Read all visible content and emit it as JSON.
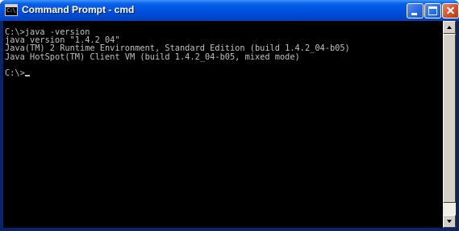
{
  "window": {
    "title": "Command Prompt - cmd",
    "icon": "cmd-icon",
    "icon_text": "C:\\",
    "buttons": {
      "minimize_icon": "minimize-icon",
      "maximize_icon": "maximize-icon",
      "close_icon": "close-icon"
    }
  },
  "console": {
    "lines": [
      "C:\\>java -version",
      "java version \"1.4.2_04\"",
      "Java(TM) 2 Runtime Environment, Standard Edition (build 1.4.2_04-b05)",
      "Java HotSpot(TM) Client VM (build 1.4.2_04-b05, mixed mode)",
      "",
      "C:\\>"
    ],
    "text_color": "#c0c0c0",
    "background_color": "#000000"
  },
  "scrollbar": {
    "up_icon": "scroll-up-arrow-icon",
    "down_icon": "scroll-down-arrow-icon"
  },
  "colors": {
    "titlebar": "#0054e3",
    "close_button": "#d6552e"
  }
}
